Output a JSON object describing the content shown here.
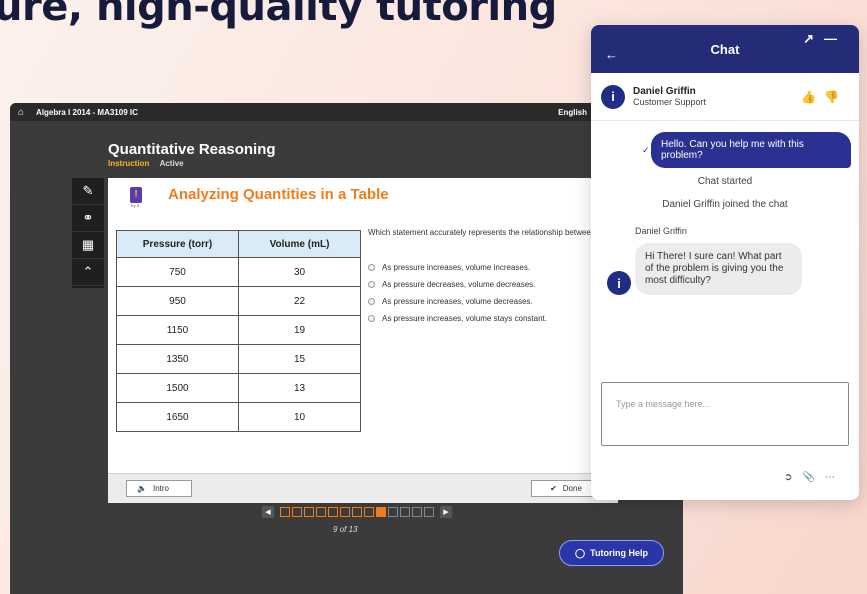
{
  "headline": "ure, high-quality tutoring",
  "lesson": {
    "course": "Algebra I 2014 - MA3109 IC",
    "language": "English",
    "title": "Quantitative Reasoning",
    "status_instruction": "Instruction",
    "status_active": "Active",
    "activity_logo": "Try It",
    "activity_title": "Analyzing Quantities in a Table",
    "table": {
      "headers": [
        "Pressure (torr)",
        "Volume (mL)"
      ],
      "rows": [
        [
          "750",
          "30"
        ],
        [
          "950",
          "22"
        ],
        [
          "1150",
          "19"
        ],
        [
          "1350",
          "15"
        ],
        [
          "1500",
          "13"
        ],
        [
          "1650",
          "10"
        ]
      ]
    },
    "question": "Which statement accurately represents the relationship between pressure and volume?",
    "options": [
      "As pressure increases, volume increases.",
      "As pressure decreases, volume decreases.",
      "As pressure increases, volume decreases.",
      "As pressure increases, volume stays constant."
    ],
    "intro_label": "Intro",
    "done_label": "Done",
    "pager": {
      "current": 9,
      "total": 13,
      "label": "9 of 13"
    },
    "tutoring_label": "Tutoring Help"
  },
  "chat": {
    "title": "Chat",
    "agent_name": "Daniel Griffin",
    "agent_role": "Customer Support",
    "user_message": "Hello. Can you help me with this problem?",
    "system_1": "Chat started",
    "system_2": "Daniel Griffin joined the chat",
    "agent_label": "Daniel Griffin",
    "agent_message": "Hi There! I sure can! What part of the problem is giving you the most difficulty?",
    "placeholder": "Type a message here..."
  },
  "colors": {
    "accent_orange": "#f07d1a",
    "chat_navy": "#242c78",
    "tutor_blue": "#2a35a8"
  }
}
